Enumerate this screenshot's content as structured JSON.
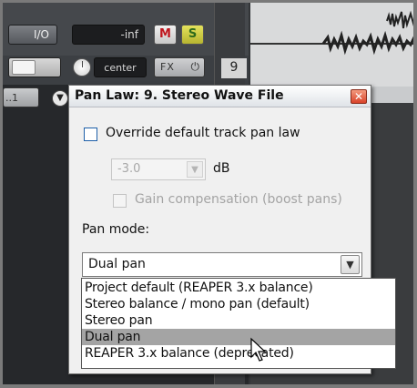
{
  "track": {
    "io_label": "I/O",
    "volume_readout": "-inf",
    "mute_label": "M",
    "solo_label": "S",
    "pan_label": "center",
    "fx_label": "FX",
    "fx_power_icon": "power-icon",
    "track_number": "9",
    "mode_selector_label": "..1"
  },
  "dialog": {
    "title": "Pan Law: 9. Stereo Wave File",
    "close_label": "✕",
    "override_label": "Override default track pan law",
    "db_value": "-3.0",
    "db_unit": "dB",
    "gain_comp_label": "Gain compensation (boost pans)",
    "pan_mode_label": "Pan mode:",
    "pan_mode_value": "Dual pan",
    "options": [
      "Project default (REAPER 3.x balance)",
      "Stereo balance / mono pan (default)",
      "Stereo pan",
      "Dual pan",
      "REAPER 3.x balance (deprecated)"
    ],
    "selected_option_index": 3
  },
  "colors": {
    "selected_highlight": "#a4a4a4",
    "close_button": "#d9432a",
    "solo_button": "#e4e25c",
    "mute_text": "#c0161e"
  }
}
